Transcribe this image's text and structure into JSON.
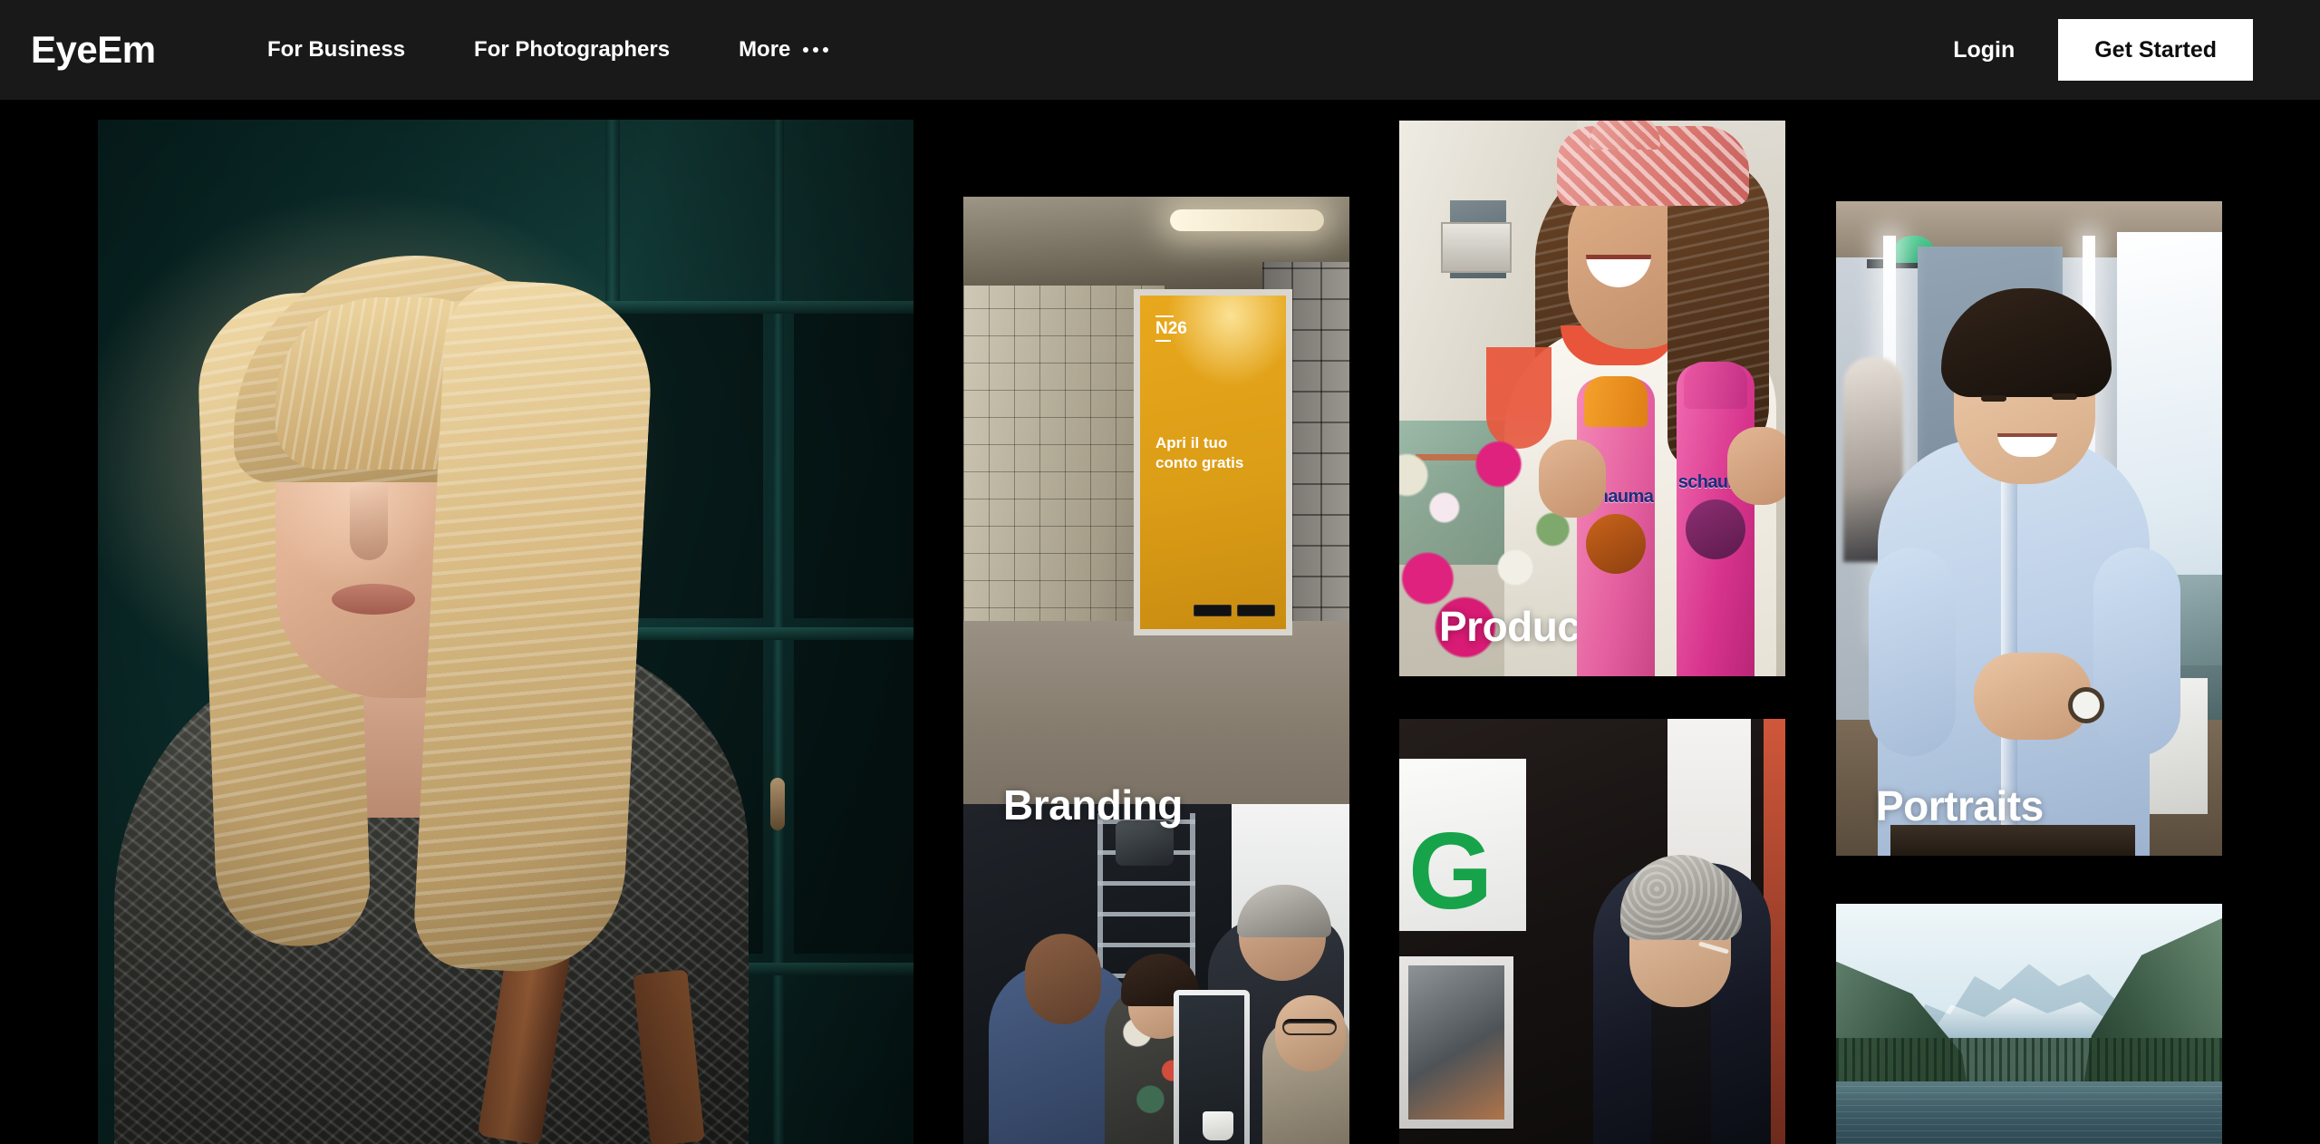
{
  "site": {
    "brand": "EyeEm",
    "background_color": "#000000",
    "header_color": "#191919",
    "accent_color": "#ffffff"
  },
  "header": {
    "logo": "EyeEm",
    "nav": [
      {
        "label": "For Business",
        "icon": ""
      },
      {
        "label": "For Photographers",
        "icon": ""
      },
      {
        "label": "More",
        "icon": "ellipsis-icon"
      }
    ],
    "login_label": "Login",
    "cta_label": "Get Started"
  },
  "hero": {
    "label": "",
    "alt": "Portrait of a blonde woman in a patterned sweater standing by a dark teal window"
  },
  "cards": [
    {
      "id": "branding",
      "label": "Branding",
      "alt": "N26 advertising poster in a subway station with tiled walls",
      "poster": {
        "logo": "N26",
        "headline_line1": "Apri il tuo",
        "headline_line2": "conto gratis"
      }
    },
    {
      "id": "product",
      "label": "Product",
      "alt": "Smiling woman with a pink headscarf holding two Schauma shampoo bottles",
      "product_brand": "schauma"
    },
    {
      "id": "portraits",
      "label": "Portraits",
      "alt": "Smiling man in a light blue shirt in a bright modern office"
    },
    {
      "id": "business",
      "label": "",
      "alt": "Team of colleagues collaborating around a monitor on a film set"
    },
    {
      "id": "speaker",
      "label": "",
      "alt": "Speaker on stage in front of a large green G logo"
    },
    {
      "id": "nature",
      "label": "",
      "alt": "Misty mountain range reflected in a calm alpine lake"
    }
  ]
}
